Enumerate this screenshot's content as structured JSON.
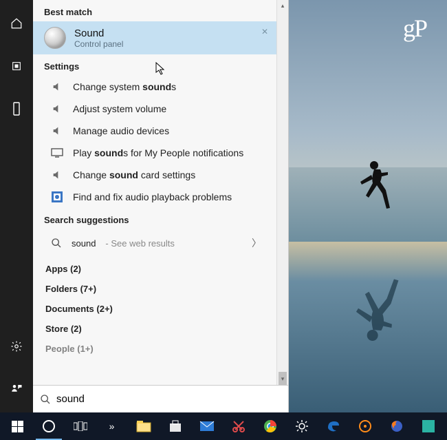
{
  "watermark": "gP",
  "headings": {
    "best_match": "Best match",
    "settings": "Settings",
    "search_suggestions": "Search suggestions"
  },
  "best": {
    "title": "Sound",
    "subtitle": "Control panel"
  },
  "settings_items": [
    {
      "pre": "Change system ",
      "bold": "sound",
      "post": "s",
      "icon": "speaker"
    },
    {
      "pre": "Adjust system volume",
      "bold": "",
      "post": "",
      "icon": "speaker"
    },
    {
      "pre": "Manage audio devices",
      "bold": "",
      "post": "",
      "icon": "speaker"
    },
    {
      "pre": "Play ",
      "bold": "sound",
      "post": "s for My People notifications",
      "icon": "monitor"
    },
    {
      "pre": "Change ",
      "bold": "sound",
      "post": " card settings",
      "icon": "speaker"
    },
    {
      "pre": "Find and fix audio playback problems",
      "bold": "",
      "post": "",
      "icon": "troubleshoot"
    }
  ],
  "suggestion": {
    "term": "sound",
    "trail": " - See web results"
  },
  "categories": [
    {
      "label": "Apps (2)"
    },
    {
      "label": "Folders (7+)"
    },
    {
      "label": "Documents (2+)"
    },
    {
      "label": "Store (2)"
    },
    {
      "label": "People (1+)"
    }
  ],
  "search_value": "sound",
  "taskbar_overflow": "»"
}
